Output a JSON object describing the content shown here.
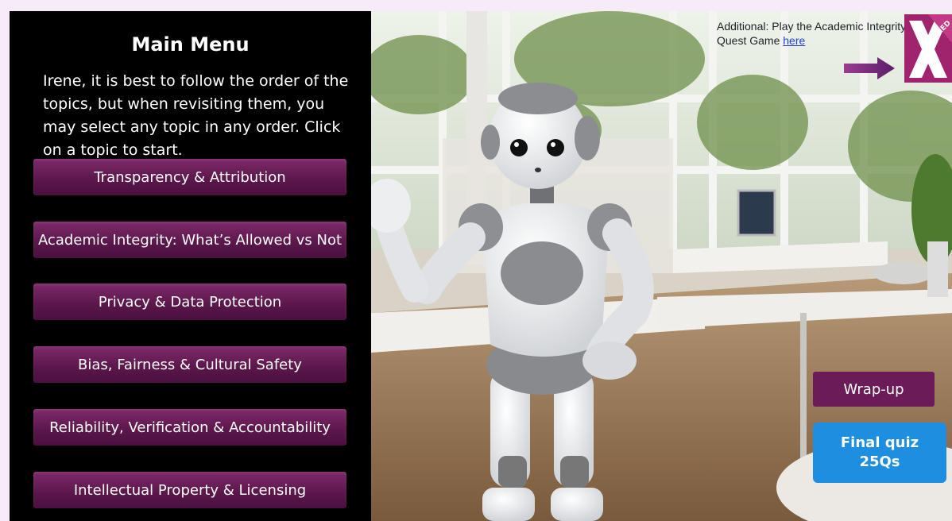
{
  "menu": {
    "title": "Main Menu",
    "intro": "Irene, it is best to follow the order of the topics, but when revisiting them, you may select any topic in any order. Click on a topic to start.",
    "topics": [
      {
        "label": "Transparency & Attribution"
      },
      {
        "label": "Academic Integrity: What’s Allowed vs Not"
      },
      {
        "label": "Privacy & Data Protection"
      },
      {
        "label": "Bias, Fairness & Cultural Safety"
      },
      {
        "label": "Reliability, Verification & Accountability"
      },
      {
        "label": "Intellectual Property & Licensing"
      }
    ]
  },
  "additional": {
    "text": "Additional: Play the Academic Integrity Quest Game ",
    "link_label": "here"
  },
  "logo": {
    "text": "JEXED"
  },
  "wrapup": {
    "label": "Wrap-up"
  },
  "final_quiz": {
    "line1": "Final quiz",
    "line2": "25Qs"
  },
  "colors": {
    "menu_bg": "#000000",
    "topic_button": "#5a1649",
    "wrapup_button": "#6b1b58",
    "quiz_button": "#1e8ee0",
    "link": "#1f3fd0",
    "page_bg": "#f6ebf6"
  }
}
